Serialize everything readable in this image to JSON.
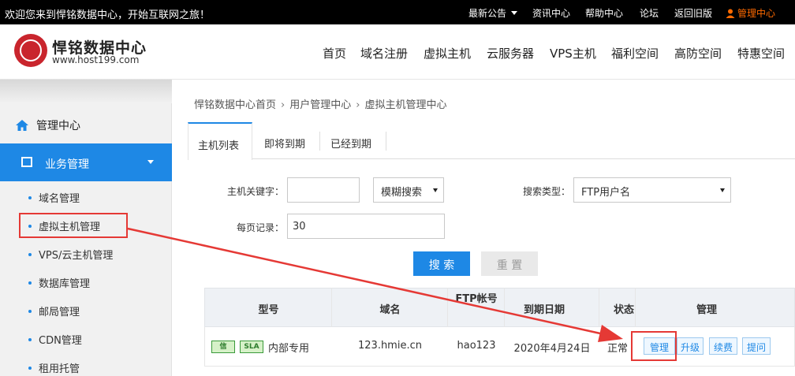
{
  "topbar": {
    "welcome": "欢迎您来到悍铭数据中心，开始互联网之旅！",
    "links": [
      "最新公告",
      "资讯中心",
      "帮助中心",
      "论坛",
      "返回旧版"
    ],
    "admin": "管理中心"
  },
  "header": {
    "site_name": "悍铭数据中心",
    "url": "www.host199.com",
    "nav": [
      "首页",
      "域名注册",
      "虚拟主机",
      "云服务器",
      "VPS主机",
      "福利空间",
      "高防空间",
      "特惠空间"
    ]
  },
  "sidebar": {
    "home": "管理中心",
    "active_section": "业务管理",
    "items": [
      "域名管理",
      "虚拟主机管理",
      "VPS/云主机管理",
      "数据库管理",
      "邮局管理",
      "CDN管理",
      "租用托管"
    ]
  },
  "breadcrumb": [
    "悍铭数据中心首页",
    "用户管理中心",
    "虚拟主机管理中心"
  ],
  "tabs": [
    "主机列表",
    "即将到期",
    "已经到期"
  ],
  "form": {
    "keyword_label": "主机关键字：",
    "keyword_value": "",
    "match_mode": "模糊搜索",
    "search_type_label": "搜索类型：",
    "search_type_value": "FTP用户名",
    "per_page_label": "每页记录：",
    "per_page_value": "30",
    "search_button": "搜 索",
    "reset_button": "重 置"
  },
  "table": {
    "headers": [
      "型号",
      "域名",
      "FTP帐号",
      "到期日期",
      "状态",
      "管理"
    ],
    "rows": [
      {
        "badges": [
          "信",
          "SLA"
        ],
        "model": "内部专用",
        "domain": "123.hmie.cn",
        "ftp": "hao123",
        "expiry": "2020年4月24日",
        "status": "正常",
        "actions": [
          "管理",
          "升级",
          "续费",
          "提问"
        ]
      }
    ]
  },
  "colors": {
    "accent": "#1e88e5",
    "highlight": "#e53935",
    "admin": "#ff6a00"
  }
}
